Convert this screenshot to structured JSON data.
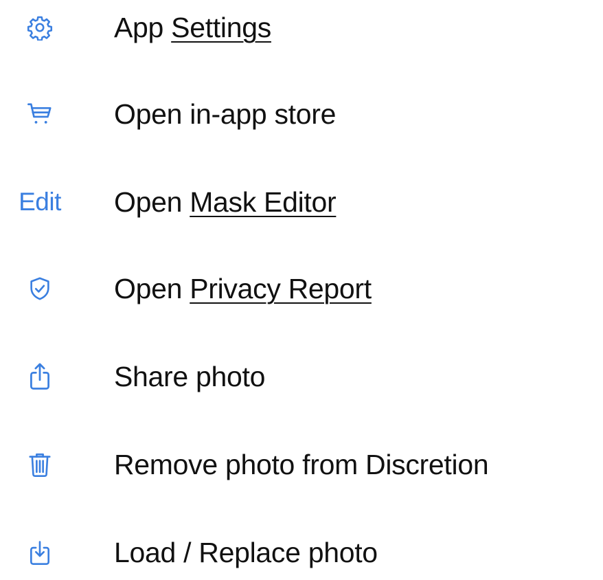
{
  "accent_color": "#3a7fe0",
  "text_color": "#111111",
  "items": [
    {
      "icon": "gear-icon",
      "prefix": "App ",
      "link": "Settings",
      "suffix": ""
    },
    {
      "icon": "cart-icon",
      "prefix": "Open in-app store",
      "link": "",
      "suffix": ""
    },
    {
      "icon_text": "Edit",
      "prefix": "Open ",
      "link": "Mask Editor",
      "suffix": ""
    },
    {
      "icon": "shield-check-icon",
      "prefix": "Open ",
      "link": "Privacy Report",
      "suffix": ""
    },
    {
      "icon": "share-icon",
      "prefix": "Share photo",
      "link": "",
      "suffix": ""
    },
    {
      "icon": "trash-icon",
      "prefix": "Remove photo from Discretion",
      "link": "",
      "suffix": ""
    },
    {
      "icon": "download-icon",
      "prefix": "Load / Replace photo",
      "link": "",
      "suffix": ""
    }
  ]
}
